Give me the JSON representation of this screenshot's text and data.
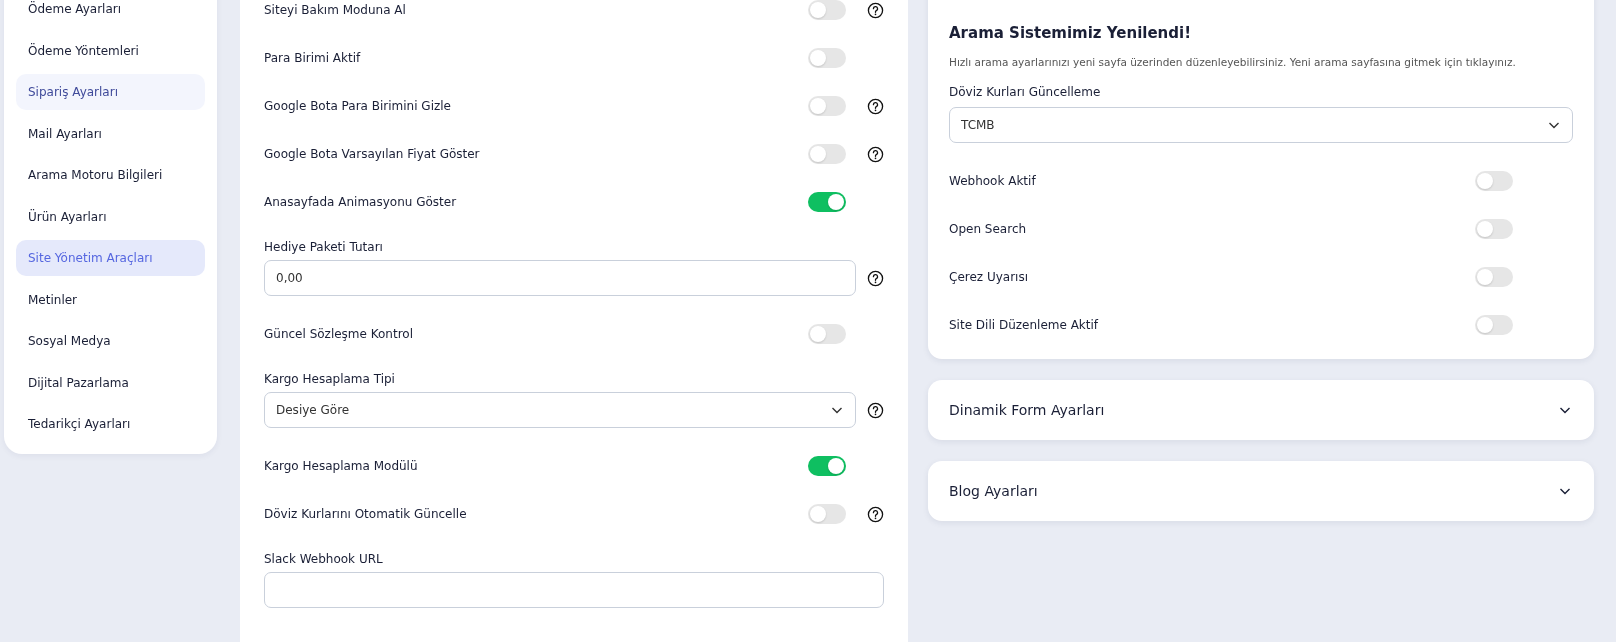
{
  "sidebar": {
    "items": [
      {
        "label": "Ödeme Ayarları",
        "selected": false,
        "hovered": false
      },
      {
        "label": "Ödeme Yöntemleri",
        "selected": false,
        "hovered": false
      },
      {
        "label": "Sipariş Ayarları",
        "selected": false,
        "hovered": true
      },
      {
        "label": "Mail Ayarları",
        "selected": false,
        "hovered": false
      },
      {
        "label": "Arama Motoru Bilgileri",
        "selected": false,
        "hovered": false
      },
      {
        "label": "Ürün Ayarları",
        "selected": false,
        "hovered": false
      },
      {
        "label": "Site Yönetim Araçları",
        "selected": true,
        "hovered": false
      },
      {
        "label": "Metinler",
        "selected": false,
        "hovered": false
      },
      {
        "label": "Sosyal Medya",
        "selected": false,
        "hovered": false
      },
      {
        "label": "Dijital Pazarlama",
        "selected": false,
        "hovered": false
      },
      {
        "label": "Tedarikçi Ayarları",
        "selected": false,
        "hovered": false
      }
    ]
  },
  "settings": [
    {
      "kind": "toggle",
      "label": "Siteyi Bakım Moduna Al",
      "on": false,
      "help": true
    },
    {
      "kind": "toggle",
      "label": "Para Birimi Aktif",
      "on": false,
      "help": false
    },
    {
      "kind": "toggle",
      "label": "Google Bota Para Birimini Gizle",
      "on": false,
      "help": true
    },
    {
      "kind": "toggle",
      "label": "Google Bota Varsayılan Fiyat Göster",
      "on": false,
      "help": true
    },
    {
      "kind": "toggle",
      "label": "Anasayfada Animasyonu Göster",
      "on": true,
      "help": false
    },
    {
      "kind": "input",
      "label": "Hediye Paketi Tutarı",
      "value": "0,00",
      "help": true
    },
    {
      "kind": "toggle",
      "label": "Güncel Sözleşme Kontrol",
      "on": false,
      "help": false
    },
    {
      "kind": "select",
      "label": "Kargo Hesaplama Tipi",
      "value": "Desiye Göre",
      "help": true
    },
    {
      "kind": "toggle",
      "label": "Kargo Hesaplama Modülü",
      "on": true,
      "help": false
    },
    {
      "kind": "toggle",
      "label": "Döviz Kurlarını Otomatik Güncelle",
      "on": false,
      "help": true
    },
    {
      "kind": "input",
      "label": "Slack Webhook URL",
      "help": false
    }
  ],
  "search_notice": {
    "title": "Arama Sistemimiz Yenilendi!",
    "text": "Hızlı arama ayarlarınızı yeni sayfa üzerinden düzenleyebilirsiniz. Yeni arama sayfasına gitmek için tıklayınız."
  },
  "currency_update": {
    "label": "Döviz Kurları Güncelleme",
    "value": "TCMB"
  },
  "right_toggles": [
    {
      "label": "Webhook Aktif",
      "on": false
    },
    {
      "label": "Open Search",
      "on": false
    },
    {
      "label": "Çerez Uyarısı",
      "on": false
    },
    {
      "label": "Site Dili Düzenleme Aktif",
      "on": false
    }
  ],
  "panels": [
    {
      "title": "Dinamik Form Ayarları",
      "expanded": false
    },
    {
      "title": "Blog Ayarları",
      "expanded": false
    }
  ]
}
